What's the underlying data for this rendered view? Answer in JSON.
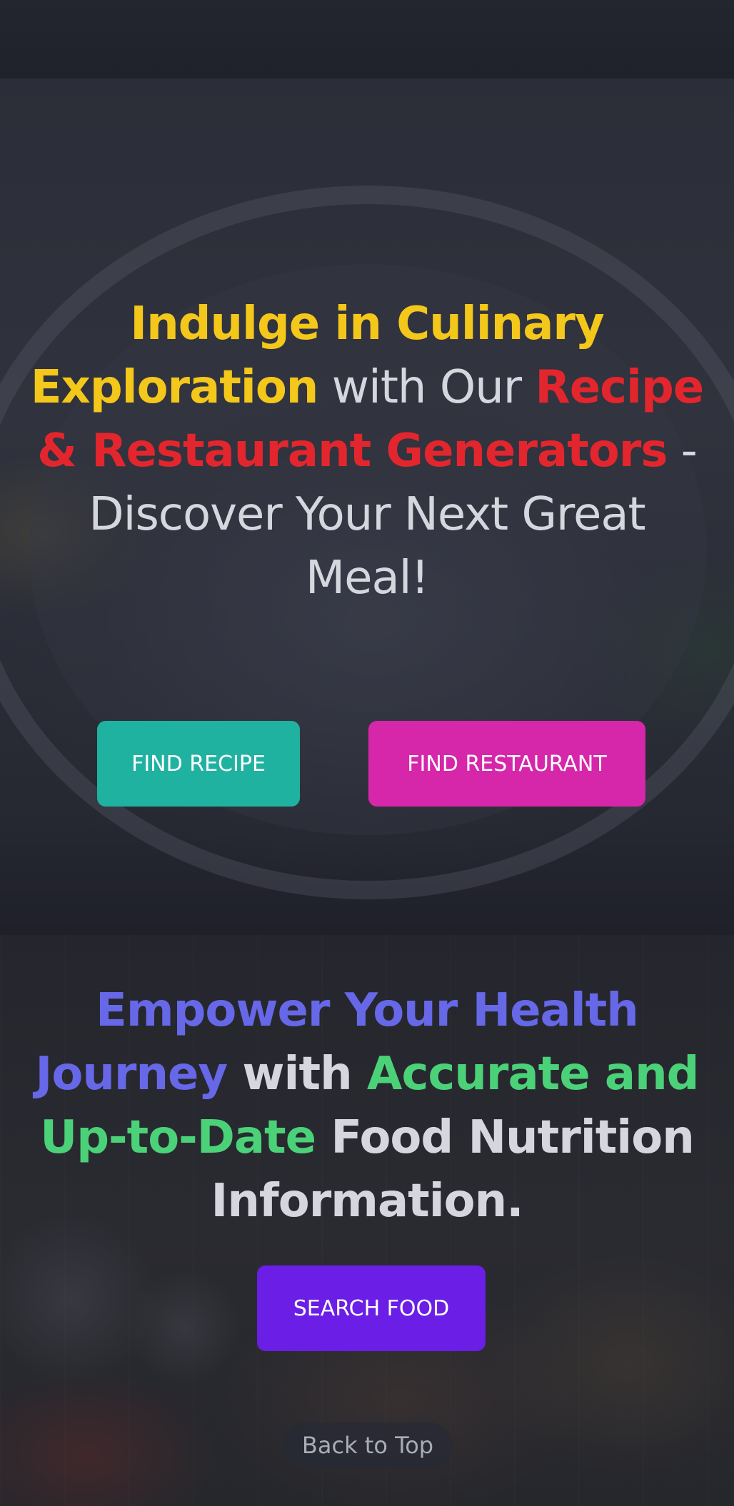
{
  "hero": {
    "title_parts": {
      "p1": "Indulge in Culinary Exploration",
      "p2": " with Our ",
      "p3": "Recipe & Restaurant Generators",
      "p4": " - Discover Your Next Great Meal!"
    },
    "find_recipe_label": "FIND RECIPE",
    "find_restaurant_label": "FIND RESTAURANT"
  },
  "nutrition": {
    "title_parts": {
      "p1": "Empower Your Health Journey",
      "p2": " with ",
      "p3": "Accurate and Up-to-Date",
      "p4": " Food Nutrition Information."
    },
    "search_food_label": "SEARCH FOOD"
  },
  "footer": {
    "back_to_top_label": "Back to Top"
  },
  "colors": {
    "accent_yellow": "#f4c71b",
    "accent_red": "#e3262d",
    "accent_blue": "#6668e8",
    "accent_green": "#4bd279",
    "recipe_button": "#20b2a1",
    "restaurant_button": "#d626aa",
    "search_button": "#6a1ee6"
  }
}
